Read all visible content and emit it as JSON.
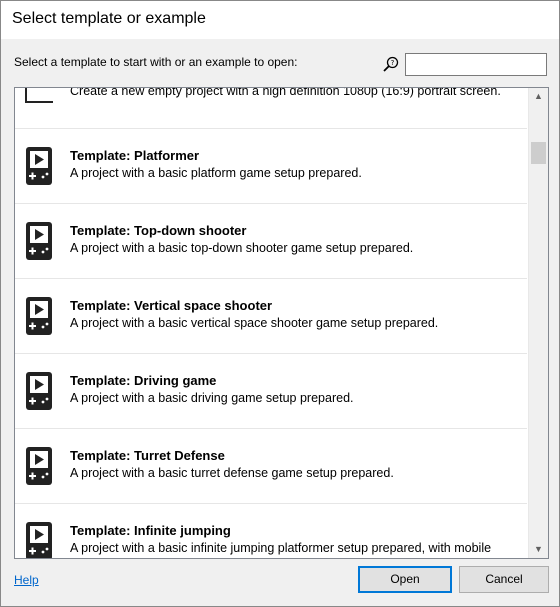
{
  "window": {
    "title": "Select template or example"
  },
  "prompt_label": "Select a template to start with or an example to open:",
  "search": {
    "icon": "search-icon",
    "value": ""
  },
  "list": {
    "partial_item": {
      "desc": "Create a new empty project with a high definition 1080p (16:9) portrait screen."
    },
    "items": [
      {
        "name": "Template: Platformer",
        "desc": "A project with a basic platform game setup prepared.",
        "icon": "gamepad-icon"
      },
      {
        "name": "Template: Top-down shooter",
        "desc": "A project with a basic top-down shooter game setup prepared.",
        "icon": "gamepad-icon"
      },
      {
        "name": "Template: Vertical space shooter",
        "desc": "A project with a basic vertical space shooter game setup prepared.",
        "icon": "gamepad-icon"
      },
      {
        "name": "Template: Driving game",
        "desc": "A project with a basic driving game setup prepared.",
        "icon": "gamepad-icon"
      },
      {
        "name": "Template: Turret Defense",
        "desc": "A project with a basic turret defense game setup prepared.",
        "icon": "gamepad-icon"
      },
      {
        "name": "Template: Infinite jumping",
        "desc": "A project with a basic infinite jumping platformer setup prepared, with mobile control support.",
        "icon": "gamepad-icon"
      }
    ]
  },
  "footer": {
    "help_label": "Help",
    "open_label": "Open",
    "cancel_label": "Cancel"
  }
}
